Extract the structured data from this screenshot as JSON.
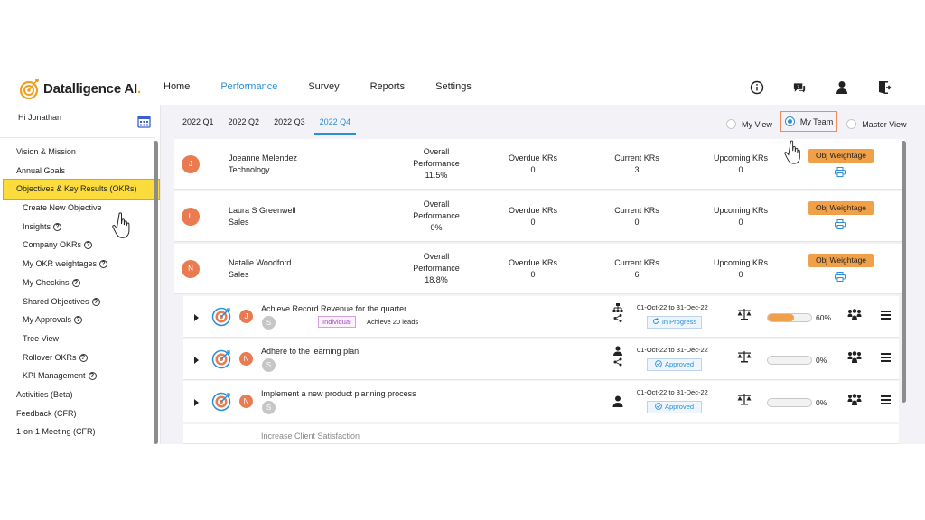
{
  "app": {
    "logo_text": "Datalligence AI",
    "logo_dot": ".",
    "brand_color": "#f0a020",
    "accent_color": "#2a8fd8"
  },
  "nav": {
    "items": [
      "Home",
      "Performance",
      "Survey",
      "Reports",
      "Settings"
    ],
    "active": "Performance"
  },
  "header_icons": [
    "info-icon",
    "chat-help-icon",
    "user-icon",
    "logout-icon"
  ],
  "sidebar": {
    "greeting": "Hi Jonathan",
    "items": [
      {
        "label": "Vision & Mission",
        "level": 0
      },
      {
        "label": "Annual Goals",
        "level": 0
      },
      {
        "label": "Objectives & Key Results (OKRs)",
        "level": 0,
        "highlighted": true
      },
      {
        "label": "Create New Objective",
        "level": 1
      },
      {
        "label": "Insights",
        "level": 1,
        "help": true
      },
      {
        "label": "Company OKRs",
        "level": 1,
        "help": true
      },
      {
        "label": "My OKR weightages",
        "level": 1,
        "help": true
      },
      {
        "label": "My Checkins",
        "level": 1,
        "help": true
      },
      {
        "label": "Shared Objectives",
        "level": 1,
        "help": true
      },
      {
        "label": "My Approvals",
        "level": 1,
        "help": true
      },
      {
        "label": "Tree View",
        "level": 1
      },
      {
        "label": "Rollover OKRs",
        "level": 1,
        "help": true
      },
      {
        "label": "KPI Management",
        "level": 1,
        "help": true
      },
      {
        "label": "Activities (Beta)",
        "level": 0
      },
      {
        "label": "Feedback (CFR)",
        "level": 0
      },
      {
        "label": "1-on-1 Meeting (CFR)",
        "level": 0
      }
    ]
  },
  "quarters": {
    "tabs": [
      "2022 Q1",
      "2022 Q2",
      "2022 Q3",
      "2022 Q4"
    ],
    "active": "2022 Q4"
  },
  "views": {
    "options": [
      "My View",
      "My Team",
      "Master View"
    ],
    "selected": "My Team"
  },
  "members": [
    {
      "initial": "J",
      "name": "Joeanne Melendez",
      "dept": "Technology",
      "perf_label_1": "Overall",
      "perf_label_2": "Performance",
      "perf": "11.5%",
      "overdue_label": "Overdue KRs",
      "overdue": "0",
      "current_label": "Current KRs",
      "current": "3",
      "upcoming_label": "Upcoming KRs",
      "upcoming": "0",
      "weightage_label": "Obj Weightage"
    },
    {
      "initial": "L",
      "name": "Laura S Greenwell",
      "dept": "Sales",
      "perf_label_1": "Overall",
      "perf_label_2": "Performance",
      "perf": "0%",
      "overdue_label": "Overdue KRs",
      "overdue": "0",
      "current_label": "Current KRs",
      "current": "0",
      "upcoming_label": "Upcoming KRs",
      "upcoming": "0",
      "weightage_label": "Obj Weightage"
    },
    {
      "initial": "N",
      "name": "Natalie Woodford",
      "dept": "Sales",
      "perf_label_1": "Overall",
      "perf_label_2": "Performance",
      "perf": "18.8%",
      "overdue_label": "Overdue KRs",
      "overdue": "0",
      "current_label": "Current KRs",
      "current": "6",
      "upcoming_label": "Upcoming KRs",
      "upcoming": "0",
      "weightage_label": "Obj Weightage"
    }
  ],
  "objectives": [
    {
      "owner": "J",
      "shared": "S",
      "title": "Achieve Record Revenue for the quarter",
      "tag": "Individual",
      "tag_text": "Achieve 20 leads",
      "type_icon": "hierarchy-share-icon",
      "dates": "01-Oct-22 to 31-Dec-22",
      "status": "In Progress",
      "status_icon": "refresh-icon",
      "progress": 0.6,
      "progress_label": "60%"
    },
    {
      "owner": "N",
      "shared": "S",
      "title": "Adhere to the learning plan",
      "type_icon": "person-share-icon",
      "dates": "01-Oct-22 to 31-Dec-22",
      "status": "Approved",
      "status_icon": "check-circle-icon",
      "progress": 0,
      "progress_label": "0%"
    },
    {
      "owner": "N",
      "shared": "S",
      "title": "Implement a new product planning process",
      "type_icon": "person-icon",
      "dates": "01-Oct-22 to 31-Dec-22",
      "status": "Approved",
      "status_icon": "check-circle-icon",
      "progress": 0,
      "progress_label": "0%"
    }
  ],
  "partial_row": {
    "title": "Increase Client Satisfaction"
  }
}
